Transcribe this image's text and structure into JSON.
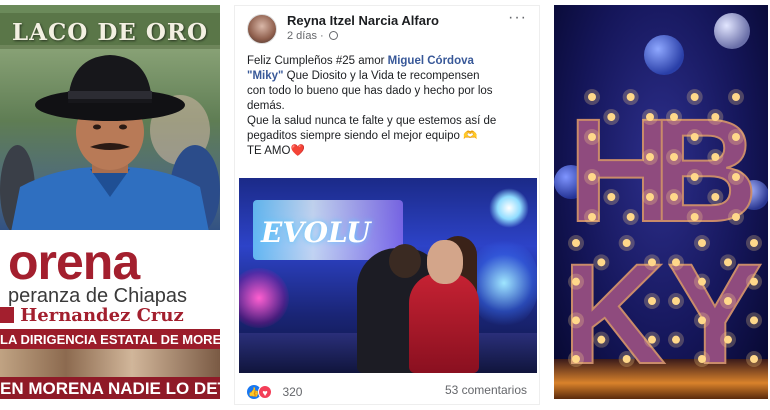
{
  "left_panel": {
    "top_title": "LACO DE ORO",
    "brand": "orena",
    "subtitle": "peranza de Chiapas",
    "name": "Hernandez Cruz",
    "strip_text": "LA DIRIGENCIA ESTATAL DE MORENA",
    "bottom_text": "EN MORENA NADIE LO DETIE",
    "colors": {
      "brand_red": "#a31f2e",
      "strip_red": "#9b1c2a"
    }
  },
  "post": {
    "author": "Reyna Itzel Narcia Alfaro",
    "time": "2 días ·",
    "more_icon": "···",
    "text_lines": [
      {
        "prefix": "Feliz Cumpleños #25 amor ",
        "mention": "Miguel Córdova"
      },
      {
        "mention": "\"Miky\"",
        "suffix": "  Que Diosito y la Vida te recompensen"
      },
      {
        "text": "con todo lo bueno que has dado y hecho por los"
      },
      {
        "text": "demás."
      },
      {
        "text": "Que la salud nunca te falte y que estemos así de"
      },
      {
        "text": "pegaditos siempre siendo el mejor equipo 🫶"
      },
      {
        "text": "TE AMO❤️"
      }
    ],
    "photo_sign": "EVOLU",
    "reaction_count": "320",
    "comments": "53 comentarios",
    "colors": {
      "mention": "#385898",
      "like": "#1877f2",
      "love": "#f33e58"
    }
  },
  "right_panel": {
    "letters": [
      "H",
      "B",
      "K",
      "Y"
    ],
    "colors": {
      "bulb": "#ffd98a",
      "letter_fill": "#8f4b7e"
    }
  }
}
